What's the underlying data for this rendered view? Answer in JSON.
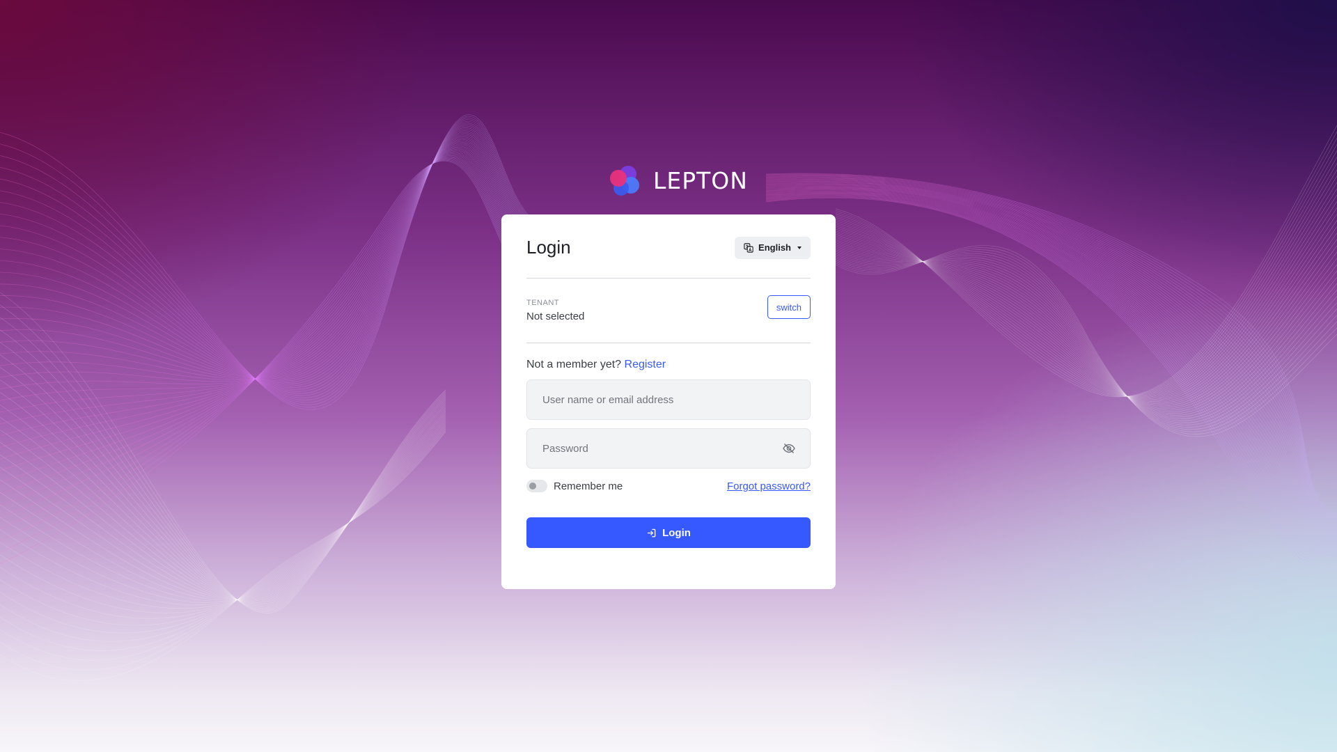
{
  "brand": {
    "name": "LEPTON",
    "colors": {
      "pink": "#e8317c",
      "purple": "#7b3fe4",
      "blue": "#4a7dff"
    }
  },
  "card": {
    "title": "Login",
    "language": {
      "selected": "English",
      "icon": "language-icon"
    }
  },
  "tenant": {
    "label": "TENANT",
    "value": "Not selected",
    "switch_label": "switch"
  },
  "register": {
    "prompt": "Not a member yet?",
    "link_label": "Register"
  },
  "form": {
    "username_placeholder": "User name or email address",
    "password_placeholder": "Password",
    "password_icon": "eye-slash-icon",
    "remember_label": "Remember me",
    "remember_checked": false,
    "forgot_label": "Forgot password?",
    "submit_label": "Login",
    "submit_icon": "login-icon"
  },
  "colors": {
    "primary": "#3558ff",
    "card_bg": "#ffffff",
    "field_bg": "#f2f3f5"
  }
}
